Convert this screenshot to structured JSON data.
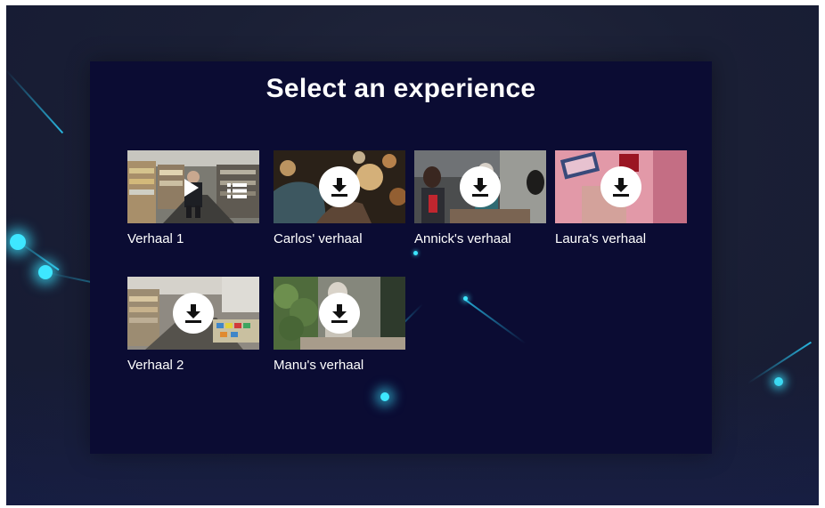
{
  "page": {
    "title": "Select an experience"
  },
  "experiences": [
    {
      "label": "Verhaal 1",
      "action": "play",
      "secondary": "list"
    },
    {
      "label": "Carlos' verhaal",
      "action": "download"
    },
    {
      "label": "Annick's verhaal",
      "action": "download"
    },
    {
      "label": "Laura's verhaal",
      "action": "download"
    },
    {
      "label": "Verhaal 2",
      "action": "download"
    },
    {
      "label": "Manu's verhaal",
      "action": "download"
    }
  ],
  "icons": {
    "download": "download-icon",
    "play": "play-icon",
    "list": "list-icon"
  },
  "colors": {
    "panel": "#0b0c33",
    "background": "#1a1f35",
    "accent_glow": "#3ee7ff",
    "text": "#ffffff",
    "button": "#ffffff"
  }
}
